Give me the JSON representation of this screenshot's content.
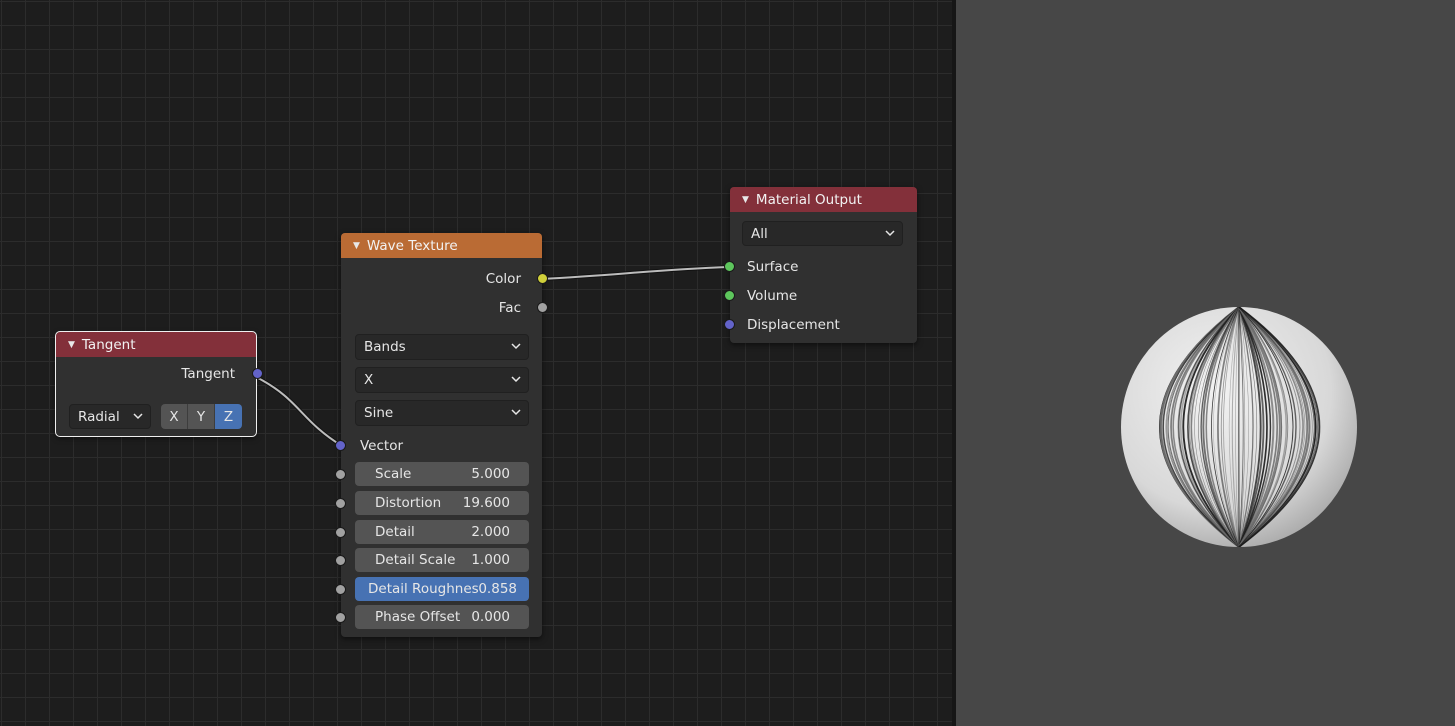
{
  "tangent_node": {
    "title": "Tangent",
    "output_label": "Tangent",
    "direction_type": "Radial",
    "axes": [
      "X",
      "Y",
      "Z"
    ],
    "active_axis": "Z"
  },
  "wave_node": {
    "title": "Wave Texture",
    "outputs": [
      "Color",
      "Fac"
    ],
    "wave_type": "Bands",
    "bands_direction": "X",
    "wave_profile": "Sine",
    "vector_label": "Vector",
    "fields": [
      {
        "label": "Scale",
        "value": "5.000"
      },
      {
        "label": "Distortion",
        "value": "19.600"
      },
      {
        "label": "Detail",
        "value": "2.000"
      },
      {
        "label": "Detail Scale",
        "value": "1.000"
      },
      {
        "label": "Detail Roughnes",
        "value": "0.858"
      },
      {
        "label": "Phase Offset",
        "value": "0.000"
      }
    ],
    "active_field": "Detail Roughnes"
  },
  "output_node": {
    "title": "Material Output",
    "target": "All",
    "inputs": [
      "Surface",
      "Volume",
      "Displacement"
    ]
  },
  "colors": {
    "editor_bg": "#1d1d1d",
    "node_bg": "#303030",
    "header_red": "#83303a",
    "header_orange": "#ba6b34",
    "socket_yellow": "#d0cf3a",
    "socket_grey": "#a1a1a1",
    "socket_blue": "#6363c9",
    "socket_green": "#5dc55c",
    "active_blue": "#4772b3",
    "viewport_bg": "#474747"
  }
}
